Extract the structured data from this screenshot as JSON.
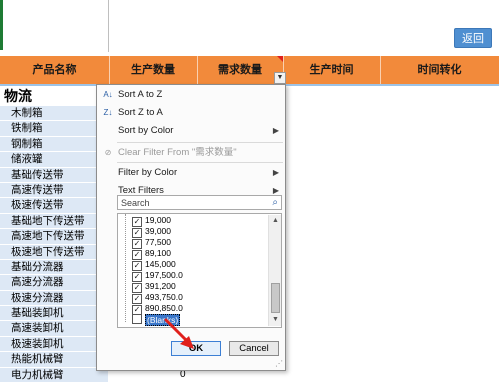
{
  "header": {
    "back_label": "返回",
    "columns": [
      "产品名称",
      "生产数量",
      "需求数量",
      "生产时间",
      "时间转化"
    ],
    "filter_dropdown_icon": "triangle-down-icon"
  },
  "left": {
    "group_title": "物流",
    "items": [
      "木制箱",
      "铁制箱",
      "钢制箱",
      "储液罐",
      "基础传送带",
      "高速传送带",
      "极速传送带",
      "基础地下传送带",
      "高速地下传送带",
      "极速地下传送带",
      "基础分流器",
      "高速分流器",
      "极速分流器",
      "基础装卸机",
      "高速装卸机",
      "极速装卸机",
      "热能机械臂",
      "电力机械臂"
    ],
    "visible_value": "0"
  },
  "filter_menu": {
    "sort_az": "Sort A to Z",
    "sort_za": "Sort Z to A",
    "sort_by_color": "Sort by Color",
    "clear_filter": "Clear Filter From \"需求数量\"",
    "filter_by_color": "Filter by Color",
    "text_filters": "Text Filters",
    "search_placeholder": "Search",
    "values": [
      {
        "label": "19,000",
        "checked": true
      },
      {
        "label": "39,000",
        "checked": true
      },
      {
        "label": "77,500",
        "checked": true
      },
      {
        "label": "89,100",
        "checked": true
      },
      {
        "label": "145,000",
        "checked": true
      },
      {
        "label": "197,500.0",
        "checked": true
      },
      {
        "label": "391,200",
        "checked": true
      },
      {
        "label": "493,750.0",
        "checked": true
      },
      {
        "label": "890,850.0",
        "checked": true
      },
      {
        "label": "(Blanks)",
        "checked": false
      }
    ],
    "ok_label": "OK",
    "cancel_label": "Cancel"
  },
  "colors": {
    "header_orange": "#f28a3b",
    "back_button": "#4f8fd1",
    "list_bg": "#dde8f5",
    "annotation_red": "#e0201c"
  }
}
